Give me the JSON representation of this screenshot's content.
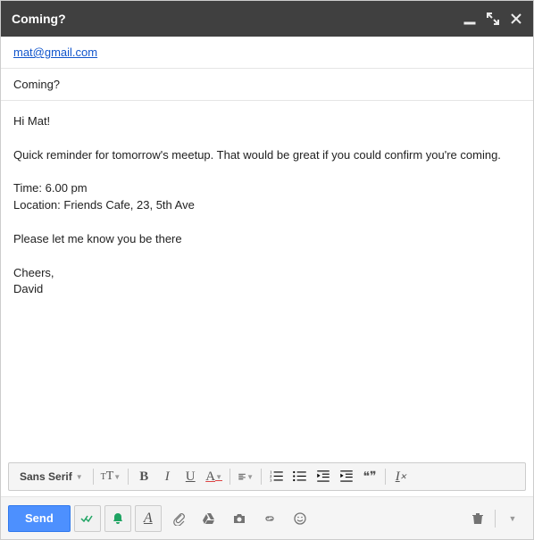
{
  "window": {
    "title": "Coming?"
  },
  "to": "mat@gmail.com",
  "subject": "Coming?",
  "body": "Hi Mat!\n\nQuick reminder for tomorrow's meetup. That would be great if you could confirm you're coming.\n\nTime: 6.00 pm\nLocation: Friends Cafe, 23, 5th Ave\n\nPlease let me know you be there\n\nCheers,\nDavid",
  "format": {
    "font": "Sans Serif",
    "size": "ᴛT",
    "bold": "B",
    "italic": "I",
    "underline": "U",
    "textcolor": "A",
    "align": "≡",
    "numlist": "≣",
    "bulletlist": "≣",
    "indentless": "⇤",
    "indentmore": "⇥",
    "quote": "❝❞",
    "clear": "Iₓ"
  },
  "bottom": {
    "send": "Send"
  }
}
